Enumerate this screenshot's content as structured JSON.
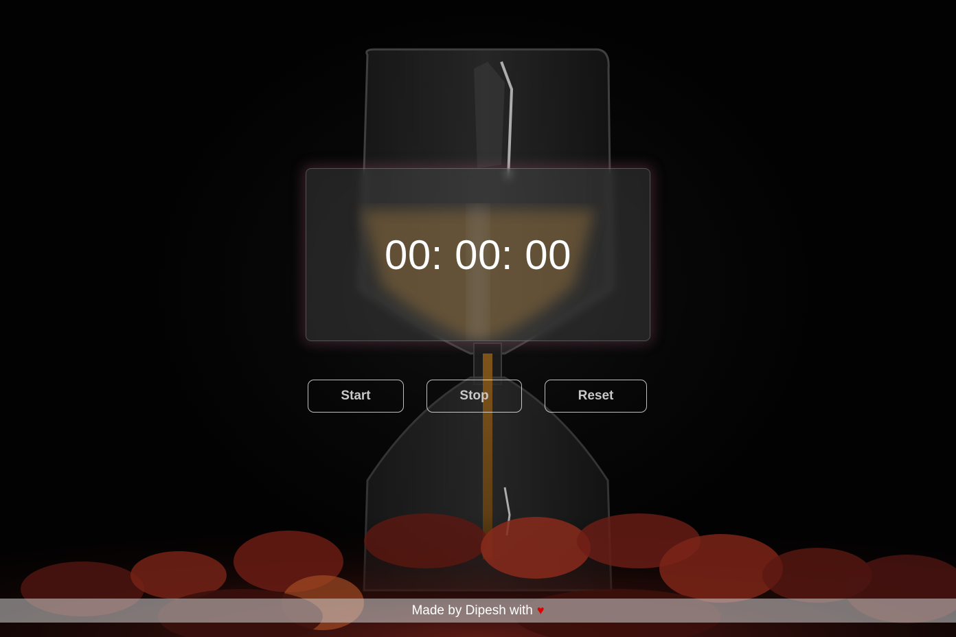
{
  "timer": {
    "display": "00: 00: 00"
  },
  "controls": {
    "start_label": "Start",
    "stop_label": "Stop",
    "reset_label": "Reset"
  },
  "footer": {
    "text": "Made by Dipesh with",
    "heart_icon": "heart-icon",
    "heart_glyph": "♥",
    "heart_color": "#e00000"
  },
  "background": {
    "subject": "hourglass-image"
  }
}
